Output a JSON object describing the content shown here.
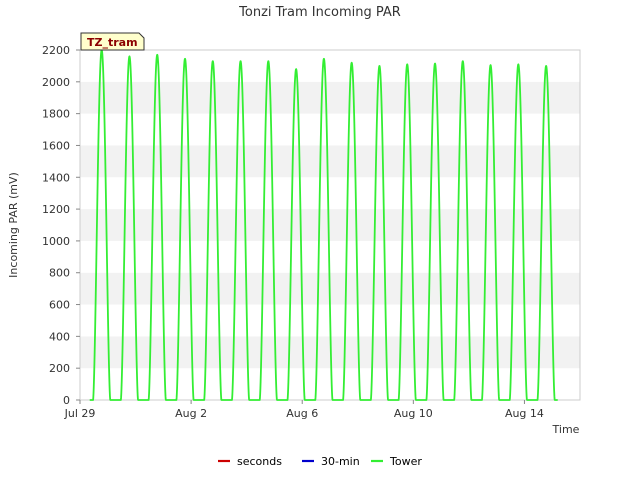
{
  "chart_data": {
    "type": "line",
    "title": "Tonzi Tram Incoming PAR",
    "site_label": "TZ_tram",
    "xlabel": "Time",
    "ylabel": "Incoming PAR (mV)",
    "x_ticks": [
      {
        "day": 0,
        "label": "Jul 29"
      },
      {
        "day": 4,
        "label": "Aug 2"
      },
      {
        "day": 8,
        "label": "Aug 6"
      },
      {
        "day": 12,
        "label": "Aug 10"
      },
      {
        "day": 16,
        "label": "Aug 14"
      }
    ],
    "y_ticks": [
      0,
      200,
      400,
      600,
      800,
      1000,
      1200,
      1400,
      1600,
      1800,
      2000,
      2200
    ],
    "xlim_days": [
      0,
      18
    ],
    "ylim": [
      0,
      2200
    ],
    "grid": "horizontal bands",
    "legend_position": "bottom",
    "series": [
      {
        "name": "seconds",
        "color": "#cc0000",
        "points": []
      },
      {
        "name": "30-min",
        "color": "#0000cc",
        "points": []
      },
      {
        "name": "Tower",
        "color": "#33ee33",
        "daily_peaks": [
          {
            "day": 0.78,
            "peak": 2200
          },
          {
            "day": 1.78,
            "peak": 2160
          },
          {
            "day": 2.78,
            "peak": 2170
          },
          {
            "day": 3.78,
            "peak": 2145
          },
          {
            "day": 4.78,
            "peak": 2130
          },
          {
            "day": 5.78,
            "peak": 2130
          },
          {
            "day": 6.78,
            "peak": 2130
          },
          {
            "day": 7.78,
            "peak": 2080
          },
          {
            "day": 8.78,
            "peak": 2145
          },
          {
            "day": 9.78,
            "peak": 2120
          },
          {
            "day": 10.78,
            "peak": 2100
          },
          {
            "day": 11.78,
            "peak": 2110
          },
          {
            "day": 12.78,
            "peak": 2115
          },
          {
            "day": 13.78,
            "peak": 2130
          },
          {
            "day": 14.78,
            "peak": 2105
          },
          {
            "day": 15.78,
            "peak": 2110
          },
          {
            "day": 16.78,
            "peak": 2100
          }
        ]
      }
    ]
  }
}
